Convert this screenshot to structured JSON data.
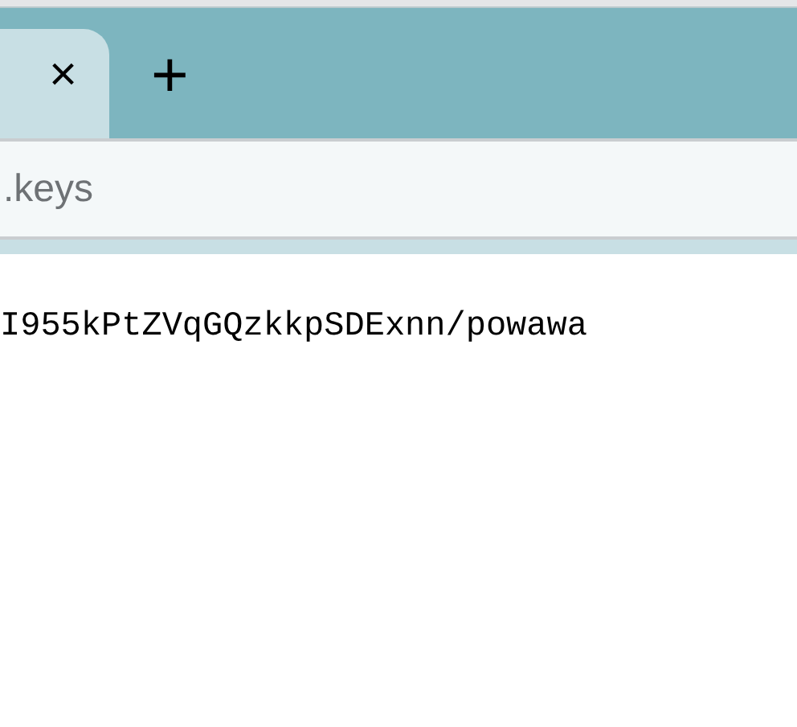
{
  "tab_bar": {
    "active_tab": {
      "close": "×",
      "selected": true
    },
    "new_tab": "+"
  },
  "address_bar": {
    "value": ".keys"
  },
  "content": {
    "text": "I955kPtZVqGQzkkpSDExnn/powawa"
  }
}
